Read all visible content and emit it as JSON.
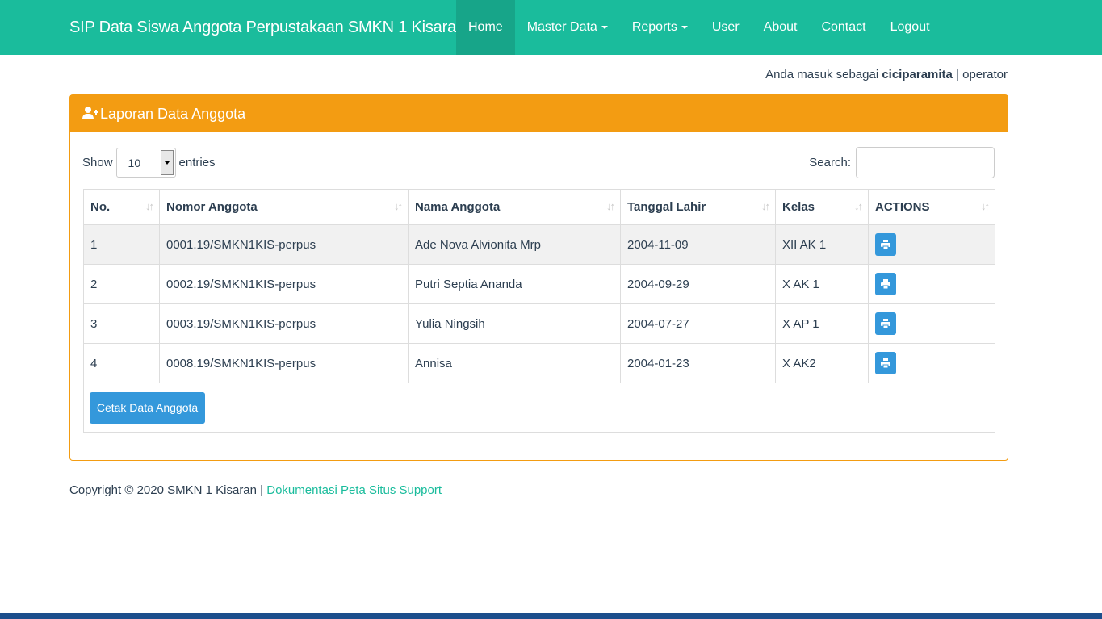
{
  "navbar": {
    "brand": "SIP Data Siswa Anggota Perpustakaan SMKN 1 Kisaran",
    "items": [
      {
        "label": "Home",
        "active": true,
        "dropdown": false
      },
      {
        "label": "Master Data",
        "active": false,
        "dropdown": true
      },
      {
        "label": "Reports",
        "active": false,
        "dropdown": true
      },
      {
        "label": "User",
        "active": false,
        "dropdown": false
      },
      {
        "label": "About",
        "active": false,
        "dropdown": false
      },
      {
        "label": "Contact",
        "active": false,
        "dropdown": false
      },
      {
        "label": "Logout",
        "active": false,
        "dropdown": false
      }
    ],
    "color": "#1abc9c"
  },
  "login": {
    "prefix": "Anda masuk sebagai",
    "username": "ciciparamita",
    "separator": "|",
    "role": "operator"
  },
  "panel": {
    "title": "Laporan Data Anggota",
    "icon": "user-plus-icon",
    "color": "#f39c12"
  },
  "table_controls": {
    "show_label": "Show",
    "entries_value": "10",
    "entries_label": "entries",
    "search_label": "Search:",
    "search_value": ""
  },
  "table": {
    "columns": [
      "No.",
      "Nomor Anggota",
      "Nama Anggota",
      "Tanggal Lahir",
      "Kelas",
      "ACTIONS"
    ],
    "rows": [
      {
        "no": "1",
        "nomor": "0001.19/SMKN1KIS-perpus",
        "nama": "Ade Nova Alvionita Mrp",
        "tanggal": "2004-11-09",
        "kelas": "XII AK 1"
      },
      {
        "no": "2",
        "nomor": "0002.19/SMKN1KIS-perpus",
        "nama": "Putri Septia Ananda",
        "tanggal": "2004-09-29",
        "kelas": "X AK 1"
      },
      {
        "no": "3",
        "nomor": "0003.19/SMKN1KIS-perpus",
        "nama": "Yulia Ningsih",
        "tanggal": "2004-07-27",
        "kelas": "X AP 1"
      },
      {
        "no": "4",
        "nomor": "0008.19/SMKN1KIS-perpus",
        "nama": "Annisa",
        "tanggal": "2004-01-23",
        "kelas": "X AK2"
      }
    ],
    "action_icon": "print-icon"
  },
  "cetak_button": "Cetak Data Anggota",
  "footer": {
    "copyright": "Copyright © 2020 SMKN 1 Kisaran |",
    "link": "Dokumentasi Peta Situs Support"
  }
}
